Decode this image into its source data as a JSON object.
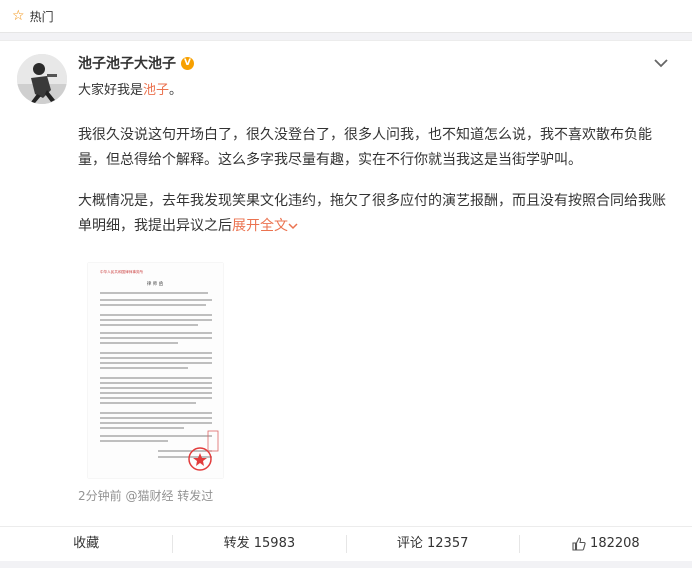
{
  "topbar": {
    "title": "热门",
    "icon": "star-icon"
  },
  "post": {
    "username": "池子池子大池子",
    "verified_badge": "V",
    "greeting_prefix": "大家好我是",
    "greeting_name": "池子",
    "greeting_suffix": "。",
    "paragraph1": "我很久没说这句开场白了，很久没登台了，很多人问我，也不知道怎么说，我不喜欢散布负能量，但总得给个解释。这么多字我尽量有趣，实在不行你就当我这是当街学驴叫。",
    "paragraph2": "大概情况是，去年我发现笑果文化违约，拖欠了很多应付的演艺报酬，而且没有按照合同给我账单明细，我提出异议之后",
    "expand_label": "展开全文",
    "time": "2分钟前",
    "source": "@猫财经 转发过",
    "document_header": "中华人民共和国律师事务所",
    "document_title": "律 师 函"
  },
  "actions": {
    "collect": "收藏",
    "repost_label": "转发",
    "repost_count": "15983",
    "comment_label": "评论",
    "comment_count": "12357",
    "like_count": "182208"
  },
  "colors": {
    "accent": "#eb7350",
    "badge": "#f7a000",
    "star": "#f28b00",
    "seal": "#e23c3c"
  }
}
